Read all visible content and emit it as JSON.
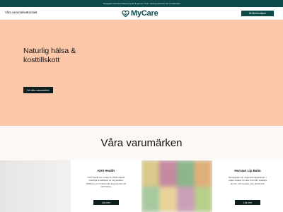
{
  "topbar": {
    "text": "Vanagata ordonkat bildanumyndi til-gamon i boin, bowing atertider kal comillsmaid"
  },
  "header": {
    "nav": [
      {
        "label": "Våra varumärken"
      },
      {
        "label": "Kontakt"
      }
    ],
    "logo_text": "MyCare",
    "partner_button": "Bli återförsäljare"
  },
  "hero": {
    "title": "Naturlig hälsa & kosttillskott",
    "cta": "Se våra varumärken",
    "background": "#fcc7a9"
  },
  "brands": {
    "title": "Våra varumärken",
    "cards": [
      {
        "name": "KIKI Health",
        "description": "KIKI Health har sedan år 1999 erbjudit naturliga kosttillskott av hög kvalitet. Hållbara och funktionella ingredienser på marknaden.",
        "button": "Läs mer"
      },
      {
        "name": "Hurraw! Lip Balm",
        "description": "Ekologiska och veganska läppbalsam i unika smaker för alla. Fritt från skadliga ämnen och testade utan djurförsök.",
        "button": "Läs mer"
      }
    ]
  },
  "colors": {
    "brand": "#0e4a4a",
    "dark_button": "#0f1e1e",
    "hero": "#fcc7a9"
  }
}
